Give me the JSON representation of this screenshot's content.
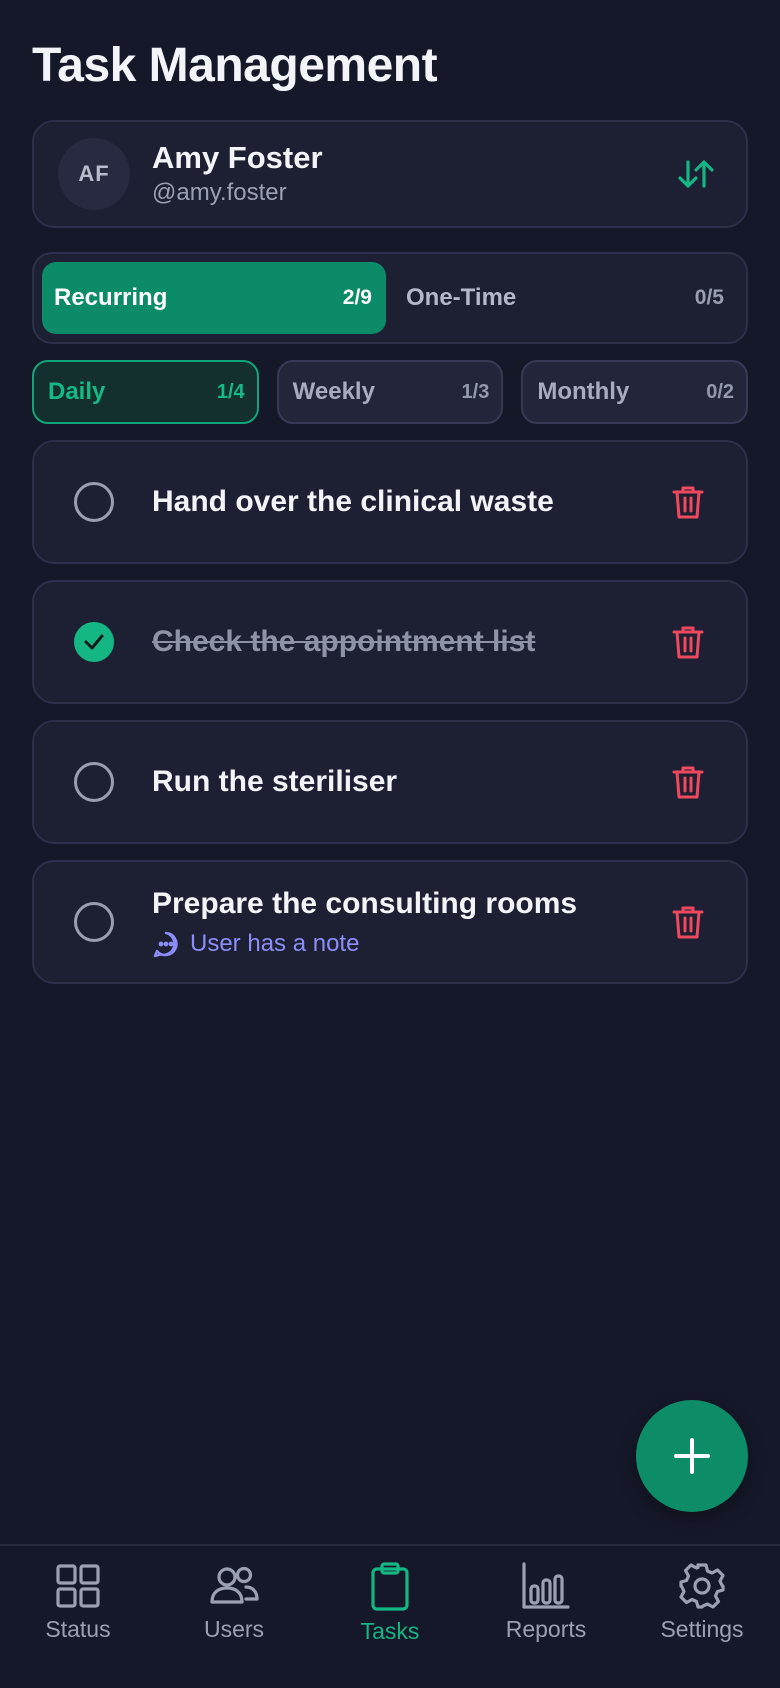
{
  "page": {
    "title": "Task Management"
  },
  "user": {
    "initials": "AF",
    "name": "Amy Foster",
    "handle": "@amy.foster"
  },
  "task_type_tabs": [
    {
      "label": "Recurring",
      "count": "2/9",
      "active": true
    },
    {
      "label": "One-Time",
      "count": "0/5",
      "active": false
    }
  ],
  "frequency_tabs": [
    {
      "label": "Daily",
      "count": "1/4",
      "active": true
    },
    {
      "label": "Weekly",
      "count": "1/3",
      "active": false
    },
    {
      "label": "Monthly",
      "count": "0/2",
      "active": false
    }
  ],
  "tasks": [
    {
      "title": "Hand over the clinical waste",
      "done": false,
      "note": ""
    },
    {
      "title": "Check the appointment list",
      "done": true,
      "note": ""
    },
    {
      "title": "Run the steriliser",
      "done": false,
      "note": ""
    },
    {
      "title": "Prepare the consulting rooms",
      "done": false,
      "note": "User has a note"
    }
  ],
  "nav": [
    {
      "label": "Status",
      "icon": "grid-icon",
      "active": false
    },
    {
      "label": "Users",
      "icon": "users-icon",
      "active": false
    },
    {
      "label": "Tasks",
      "icon": "clipboard-icon",
      "active": true
    },
    {
      "label": "Reports",
      "icon": "bar-chart-icon",
      "active": false
    },
    {
      "label": "Settings",
      "icon": "gear-icon",
      "active": false
    }
  ],
  "colors": {
    "background": "#151829",
    "accent": "#14B683",
    "danger": "#F0485E",
    "note": "#8C8DF8"
  }
}
